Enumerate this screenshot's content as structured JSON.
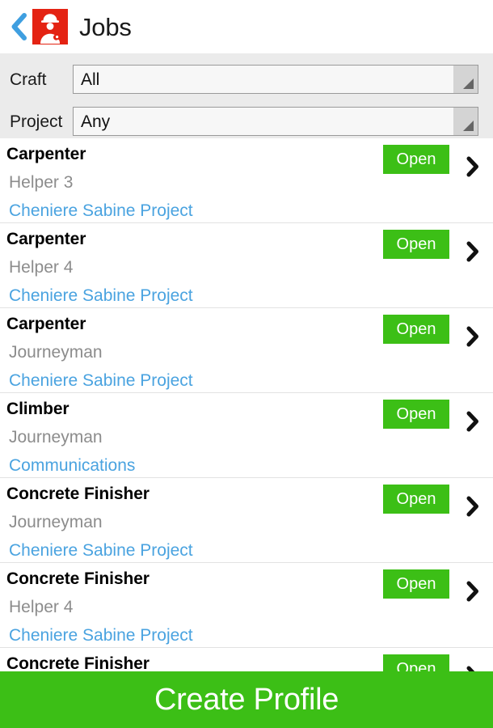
{
  "header": {
    "back_icon": "chevron-left-icon",
    "app_icon": "worker-hardhat-wrench-icon",
    "title": "Jobs",
    "accent_blue": "#3f9fe0",
    "icon_red": "#e42313"
  },
  "filters": {
    "craft": {
      "label": "Craft",
      "value": "All",
      "dropdown_icon": "spinner-triangle-icon"
    },
    "project": {
      "label": "Project",
      "value": "Any",
      "dropdown_icon": "spinner-triangle-icon"
    },
    "panel_bg": "#ebebeb"
  },
  "joblist": {
    "status_color": "#3cbf16",
    "link_color": "#4aa3e0",
    "level_color": "#8c8c8c",
    "chevron_icon": "chevron-right-icon",
    "rows": [
      {
        "title": "Carpenter",
        "level": "Helper 3",
        "project": "Cheniere Sabine Project",
        "status": "Open"
      },
      {
        "title": "Carpenter",
        "level": "Helper 4",
        "project": "Cheniere Sabine Project",
        "status": "Open"
      },
      {
        "title": "Carpenter",
        "level": "Journeyman",
        "project": "Cheniere Sabine Project",
        "status": "Open"
      },
      {
        "title": "Climber",
        "level": "Journeyman",
        "project": "Communications",
        "status": "Open"
      },
      {
        "title": "Concrete Finisher",
        "level": "Journeyman",
        "project": "Cheniere Sabine Project",
        "status": "Open"
      },
      {
        "title": "Concrete Finisher",
        "level": "Helper 4",
        "project": "Cheniere Sabine Project",
        "status": "Open"
      },
      {
        "title": "Concrete Finisher",
        "level": "",
        "project": "",
        "status": "Open"
      }
    ]
  },
  "cta": {
    "label": "Create Profile",
    "color": "#3cbf16"
  }
}
